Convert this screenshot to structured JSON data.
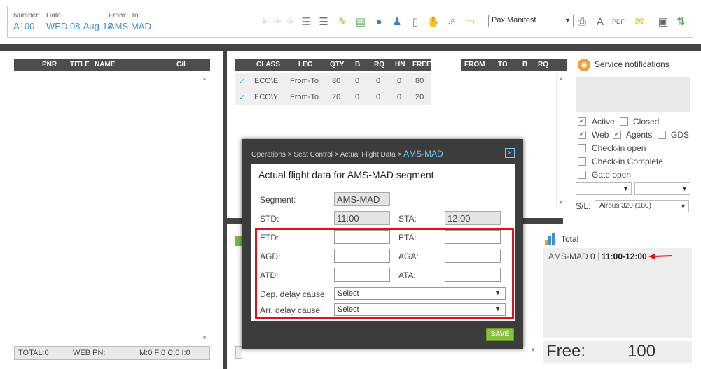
{
  "header": {
    "number_label": "Number:",
    "number_value": "A100",
    "date_label": "Date:",
    "date_value": "WED,08-Aug-18",
    "from_label": "From:",
    "from_value": "AMS",
    "to_label": "To:",
    "to_value": "MAD",
    "report_select": "Pax Manifest"
  },
  "pax_panel": {
    "columns": [
      "PNR",
      "TITLE",
      "NAME",
      "C/I"
    ],
    "footer_total": "TOTAL:0",
    "footer_web": "WEB PN:",
    "footer_counts": "M:0  F:0  C:0  I:0"
  },
  "class_panel": {
    "columns": [
      "CLASS",
      "LEG",
      "QTY",
      "B",
      "RQ",
      "HN",
      "FREE"
    ],
    "rows": [
      {
        "check": "✓",
        "class": "ECO\\E",
        "leg": "From-To",
        "qty": "80",
        "b": "0",
        "rq": "0",
        "hn": "0",
        "free": "80"
      },
      {
        "check": "✓",
        "class": "ECO\\Y",
        "leg": "From-To",
        "qty": "20",
        "b": "0",
        "rq": "0",
        "hn": "0",
        "free": "20"
      }
    ]
  },
  "route_panel": {
    "columns": [
      "FROM",
      "TO",
      "B",
      "RQ"
    ]
  },
  "service": {
    "title": "Service notifications",
    "options": [
      {
        "label": "Active",
        "checked": "✓"
      },
      {
        "label": "Closed",
        "checked": ""
      },
      {
        "label": "Web",
        "checked": "✓"
      },
      {
        "label": "Agents",
        "checked": "✓"
      },
      {
        "label": "GDS",
        "checked": ""
      },
      {
        "label": "Check-in open",
        "checked": ""
      },
      {
        "label": "Check-in Complete",
        "checked": ""
      },
      {
        "label": "Gate open",
        "checked": ""
      }
    ],
    "sl_label": "S/L:",
    "sl_value": "Airbus 320 (180)"
  },
  "total": {
    "title": "Total",
    "segment": "AMS-MAD",
    "count": "0",
    "time": "11:00-12:00",
    "free_label": "Free:",
    "free_value": "100"
  },
  "modal": {
    "breadcrumb": "Operations > Seat Control > Actual Flight Data > ",
    "breadcrumb_current": "AMS-MAD",
    "title": "Actual flight data for AMS-MAD segment",
    "segment_label": "Segment:",
    "segment_value": "AMS-MAD",
    "std_label": "STD:",
    "std_value": "11:00",
    "sta_label": "STA:",
    "sta_value": "12:00",
    "etd_label": "ETD:",
    "eta_label": "ETA:",
    "agd_label": "AGD:",
    "aga_label": "AGA:",
    "atd_label": "ATD:",
    "ata_label": "ATA:",
    "dep_delay_label": "Dep. delay cause:",
    "dep_delay_value": "Select",
    "arr_delay_label": "Arr. delay cause:",
    "arr_delay_value": "Select",
    "save_label": "SAVE",
    "close_glyph": "×"
  },
  "colors": {
    "accent": "#3a8fd6",
    "highlight": "#e3101b",
    "save": "#8bc043"
  }
}
